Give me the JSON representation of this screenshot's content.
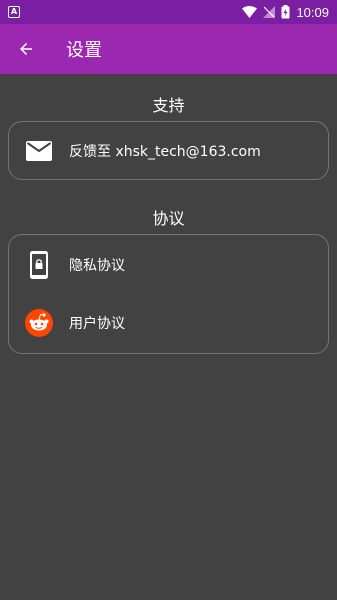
{
  "status_bar": {
    "time": "10:09",
    "app_badge": "A"
  },
  "toolbar": {
    "title": "设置"
  },
  "support": {
    "title": "支持",
    "feedback_label": "反馈至 xhsk_tech@163.com"
  },
  "agreement": {
    "title": "协议",
    "items": [
      {
        "label": "隐私协议",
        "icon": "phone-lock-icon"
      },
      {
        "label": "用户协议",
        "icon": "reddit-icon"
      }
    ]
  },
  "colors": {
    "status_bar": "#7B1FA2",
    "toolbar": "#9C27B0",
    "background": "#424242",
    "accent": "#FF4500"
  }
}
